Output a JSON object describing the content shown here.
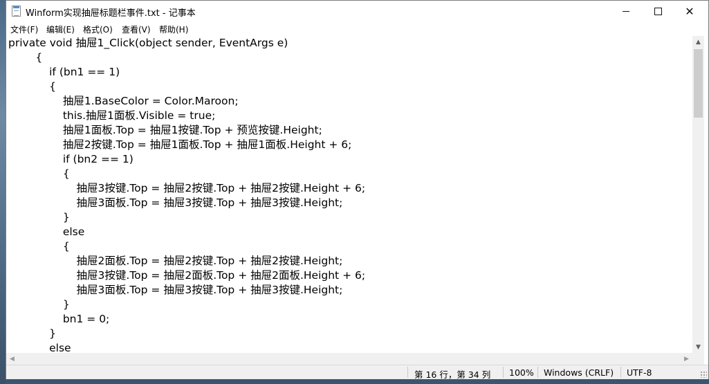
{
  "window": {
    "title": "Winform实现抽屉标题栏事件.txt - 记事本",
    "close_glyph": "✕"
  },
  "menu": [
    {
      "label": "文件(F)"
    },
    {
      "label": "编辑(E)"
    },
    {
      "label": "格式(O)"
    },
    {
      "label": "查看(V)"
    },
    {
      "label": "帮助(H)"
    }
  ],
  "editor": {
    "lines": [
      "private void 抽屉1_Click(object sender, EventArgs e)",
      "        {",
      "            if (bn1 == 1)",
      "            {",
      "                抽屉1.BaseColor = Color.Maroon;",
      "                this.抽屉1面板.Visible = true;",
      "                抽屉1面板.Top = 抽屉1按键.Top + 预览按键.Height;",
      "                抽屉2按键.Top = 抽屉1面板.Top + 抽屉1面板.Height + 6;",
      "                if (bn2 == 1)",
      "                {",
      "                    抽屉3按键.Top = 抽屉2按键.Top + 抽屉2按键.Height + 6;",
      "                    抽屉3面板.Top = 抽屉3按键.Top + 抽屉3按键.Height;",
      "                }",
      "                else",
      "                {",
      "                    抽屉2面板.Top = 抽屉2按键.Top + 抽屉2按键.Height;",
      "                    抽屉3按键.Top = 抽屉2面板.Top + 抽屉2面板.Height + 6;",
      "                    抽屉3面板.Top = 抽屉3按键.Top + 抽屉3按键.Height;",
      "                }",
      "                bn1 = 0;",
      "            }",
      "            else"
    ]
  },
  "statusbar": {
    "position": "第 16 行，第 34 列",
    "zoom": "100%",
    "line_ending": "Windows (CRLF)",
    "encoding": "UTF-8"
  }
}
